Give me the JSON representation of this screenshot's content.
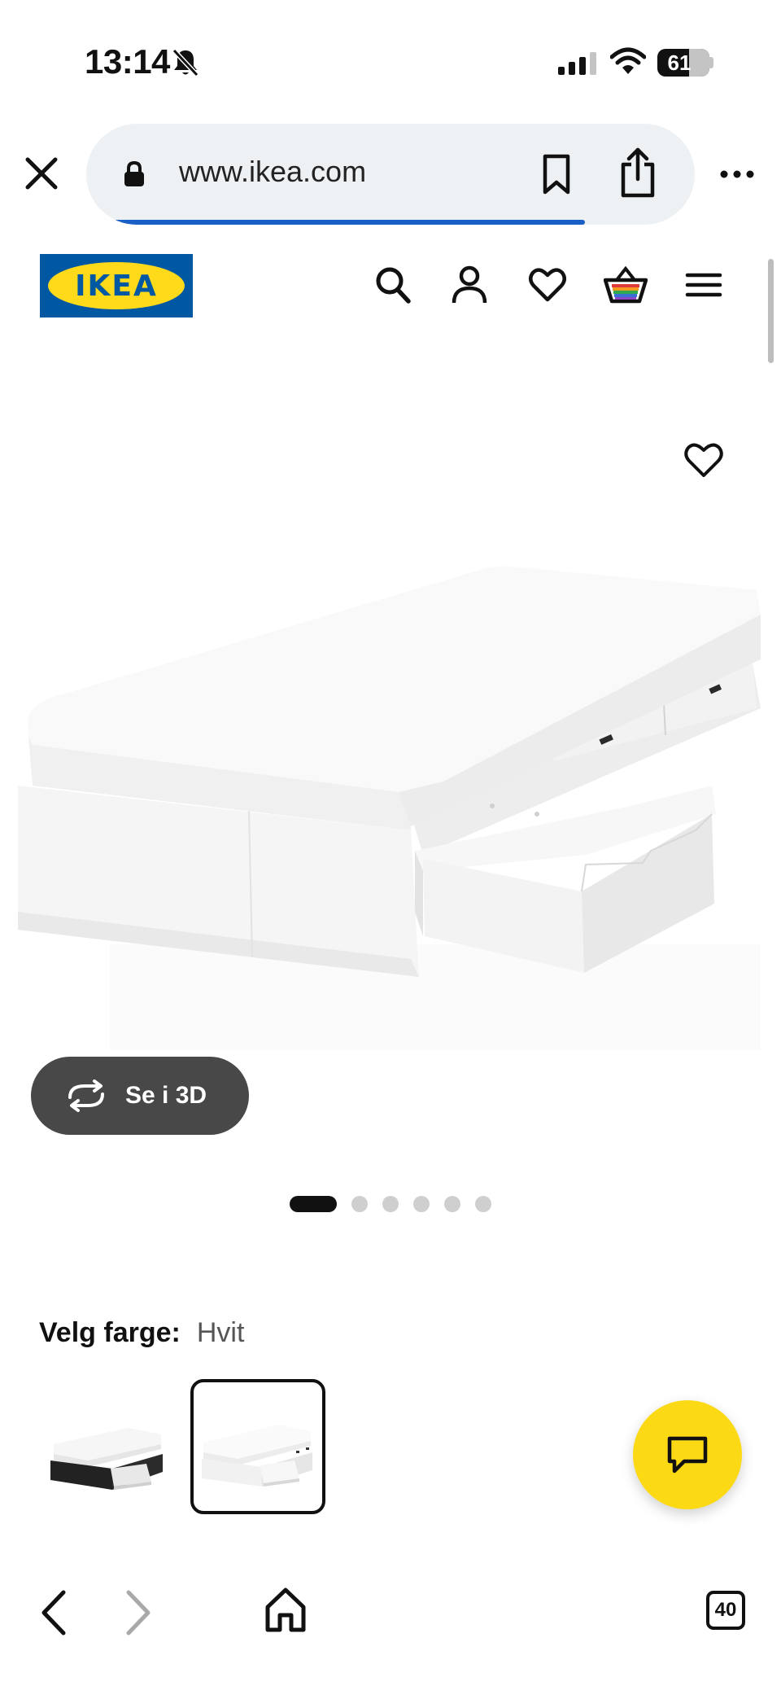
{
  "status_bar": {
    "time": "13:14",
    "battery_level": "61",
    "battery_fraction": 0.61,
    "icons": [
      "bell-slash-icon",
      "signal-icon",
      "wifi-icon",
      "battery-icon"
    ]
  },
  "browser": {
    "url": "www.ikea.com",
    "load_progress": 0.82,
    "icons": [
      "close-icon",
      "lock-icon",
      "bookmark-icon",
      "share-icon",
      "more-icon"
    ]
  },
  "header": {
    "logo_text": "IKEA",
    "icons": [
      "search-icon",
      "account-icon",
      "heart-icon",
      "cart-icon",
      "menu-icon"
    ]
  },
  "product": {
    "view_3d_label": "Se i 3D",
    "image_count": 6,
    "active_image": 1
  },
  "color_select": {
    "label": "Velg farge:",
    "value": "Hvit",
    "options": [
      {
        "name": "black-brown-variant",
        "selected": false
      },
      {
        "name": "white-variant",
        "selected": true
      }
    ]
  },
  "bottom_bar": {
    "tab_count": "40",
    "icons": [
      "back-icon",
      "forward-icon",
      "home-icon",
      "tabs-icon"
    ]
  },
  "colors": {
    "ikea_blue": "#0058a3",
    "ikea_yellow": "#ffda1a",
    "chat_yellow": "#fbd914",
    "pill_gray": "#484848",
    "progress_blue": "#1a5fc6"
  }
}
